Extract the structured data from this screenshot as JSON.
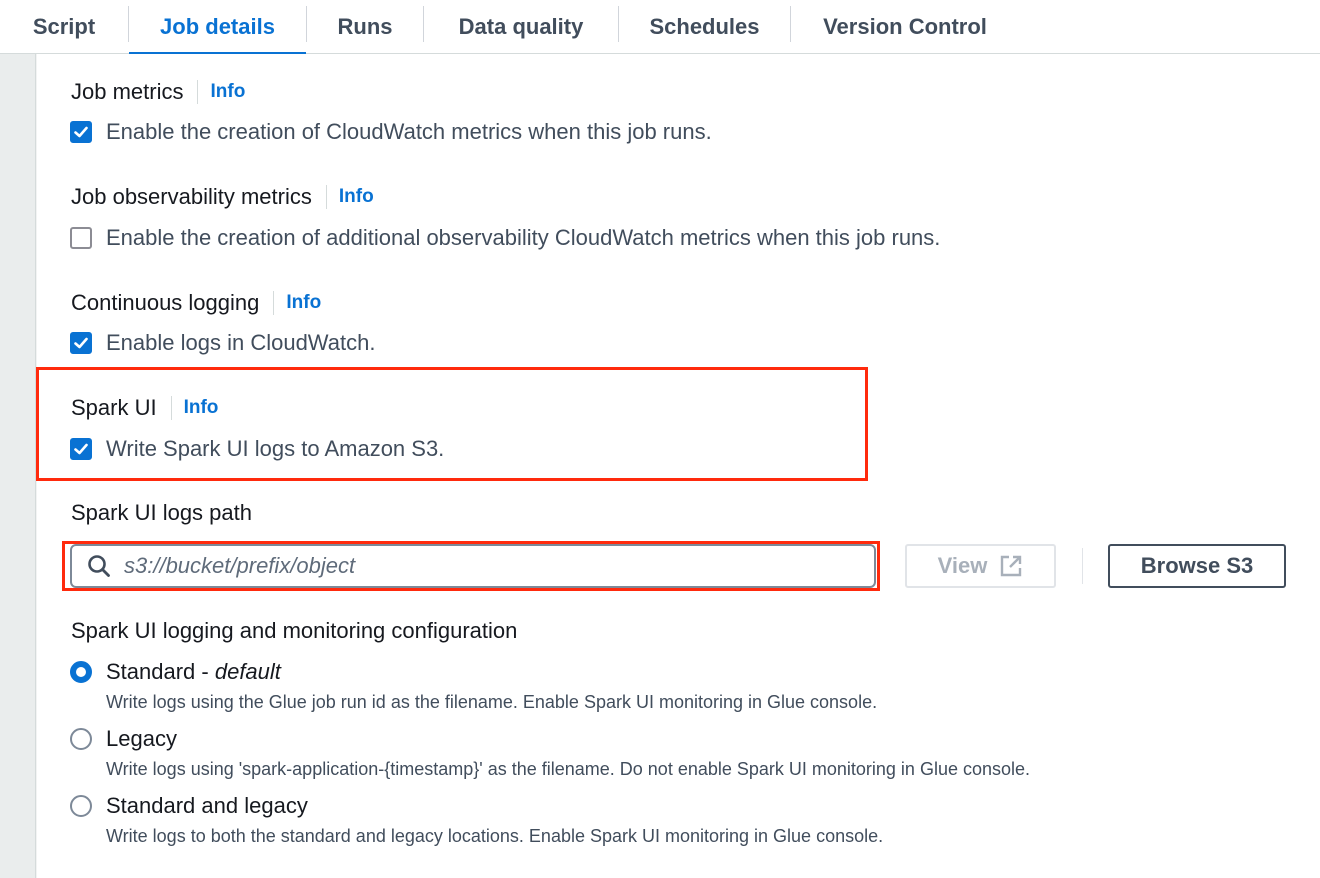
{
  "tabs": [
    {
      "label": "Script"
    },
    {
      "label": "Job details"
    },
    {
      "label": "Runs"
    },
    {
      "label": "Data quality"
    },
    {
      "label": "Schedules"
    },
    {
      "label": "Version Control"
    }
  ],
  "active_tab": "Job details",
  "sections": {
    "job_metrics": {
      "label": "Job metrics",
      "info": "Info",
      "checkbox_text": "Enable the creation of CloudWatch metrics when this job runs.",
      "checked": true
    },
    "job_observability": {
      "label": "Job observability metrics",
      "info": "Info",
      "checkbox_text": "Enable the creation of additional observability CloudWatch metrics when this job runs.",
      "checked": false
    },
    "continuous_logging": {
      "label": "Continuous logging",
      "info": "Info",
      "checkbox_text": "Enable logs in CloudWatch.",
      "checked": true
    },
    "spark_ui": {
      "label": "Spark UI",
      "info": "Info",
      "checkbox_text": "Write Spark UI logs to Amazon S3.",
      "checked": true
    }
  },
  "logs_path": {
    "label": "Spark UI logs path",
    "placeholder": "s3://bucket/prefix/object",
    "view_label": "View",
    "browse_label": "Browse S3"
  },
  "logging_config": {
    "label": "Spark UI logging and monitoring configuration",
    "options": [
      {
        "label": "Standard - ",
        "label_emphasis": "default",
        "description": "Write logs using the Glue job run id as the filename. Enable Spark UI monitoring in Glue console.",
        "selected": true
      },
      {
        "label": "Legacy",
        "label_emphasis": "",
        "description": "Write logs using 'spark-application-{timestamp}' as the filename. Do not enable Spark UI monitoring in Glue console.",
        "selected": false
      },
      {
        "label": "Standard and legacy",
        "label_emphasis": "",
        "description": "Write logs to both the standard and legacy locations. Enable Spark UI monitoring in Glue console.",
        "selected": false
      }
    ]
  },
  "colors": {
    "accent": "#0972d3",
    "highlight": "#ff2a0d"
  }
}
